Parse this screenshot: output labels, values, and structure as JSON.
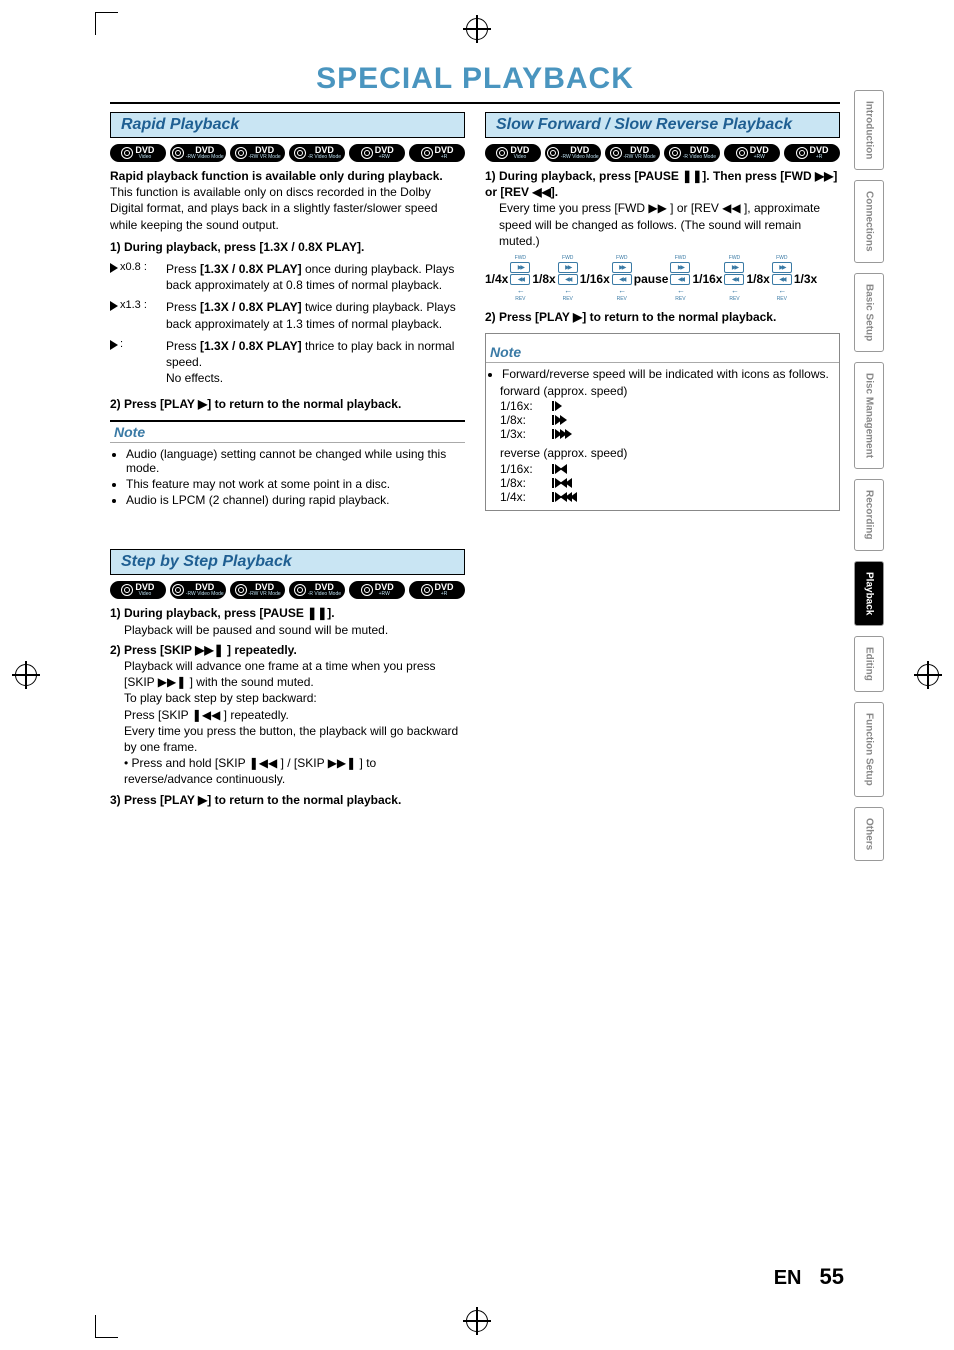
{
  "page_title": "SPECIAL PLAYBACK",
  "footer_lang": "EN",
  "footer_page": "55",
  "sidetabs": [
    "Introduction",
    "Connections",
    "Basic Setup",
    "Disc Management",
    "Recording",
    "Playback",
    "Editing",
    "Function Setup",
    "Others"
  ],
  "active_tab_index": 5,
  "disc_types": [
    {
      "main": "DVD",
      "sub": "Video"
    },
    {
      "main": "DVD",
      "sub": "-RW Video Mode"
    },
    {
      "main": "DVD",
      "sub": "-RW VR Mode"
    },
    {
      "main": "DVD",
      "sub": "-R Video Mode"
    },
    {
      "main": "DVD",
      "sub": "+RW"
    },
    {
      "main": "DVD",
      "sub": "+R"
    }
  ],
  "rapid": {
    "heading": "Rapid Playback",
    "lead": "Rapid playback function is available only during playback.",
    "desc": "This function is available only on discs recorded in the Dolby Digital format, and plays back in a slightly faster/slower speed while keeping the sound output.",
    "s1": "1) During playback, press [1.3X / 0.8X PLAY].",
    "rows": [
      {
        "mark": "x0.8 :",
        "text": "Press [1.3X / 0.8X PLAY] once during playback. Plays back approximately at 0.8 times of normal playback."
      },
      {
        "mark": "x1.3 :",
        "text": "Press [1.3X / 0.8X PLAY] twice during playback. Plays back approximately at 1.3 times of normal playback."
      },
      {
        "mark": ":",
        "text": "Press [1.3X / 0.8X PLAY] thrice to play back in normal speed.\nNo effects."
      }
    ],
    "s2": "2) Press [PLAY ▶] to return to the normal playback.",
    "note_title": "Note",
    "notes": [
      "Audio (language) setting cannot be changed while using this mode.",
      "This feature may not work at some point in a disc.",
      "Audio is LPCM (2 channel) during rapid playback."
    ]
  },
  "step": {
    "heading": "Step by Step Playback",
    "s1": "1) During playback, press [PAUSE ❚❚].",
    "s1b": "Playback will be paused and sound will be muted.",
    "s2": "2) Press [SKIP ▶▶❚ ] repeatedly.",
    "s2b": "Playback will advance one frame at a time when you press [SKIP ▶▶❚ ] with the sound muted.",
    "s2c": "To play back step by step backward:",
    "s2d": "Press [SKIP ❚◀◀ ] repeatedly.",
    "s2e": "Every time you press the button, the playback will go backward by one frame.",
    "s2f": "• Press and hold [SKIP ❚◀◀ ] / [SKIP ▶▶❚ ] to reverse/advance continuously.",
    "s3": "3) Press [PLAY ▶] to return to the normal playback."
  },
  "slow": {
    "heading": "Slow Forward / Slow Reverse Playback",
    "s1": "1) During playback, press [PAUSE ❚❚]. Then press [FWD ▶▶] or [REV ◀◀].",
    "s1b": "Every time you press [FWD ▶▶ ] or [REV ◀◀ ], approximate speed will be changed as follows. (The sound will remain muted.)",
    "speeds": [
      "1/4x",
      "1/8x",
      "1/16x",
      "pause",
      "1/16x",
      "1/8x",
      "1/3x"
    ],
    "s2": "2) Press [PLAY ▶] to return to the normal playback.",
    "note_title": "Note",
    "note_lead": "Forward/reverse speed will be indicated with icons as follows.",
    "fwd_label": "forward (approx. speed)",
    "fwd_rows": [
      "1/16x:",
      "1/8x:",
      "1/3x:"
    ],
    "rev_label": "reverse (approx. speed)",
    "rev_rows": [
      "1/16x:",
      "1/8x:",
      "1/4x:"
    ]
  }
}
